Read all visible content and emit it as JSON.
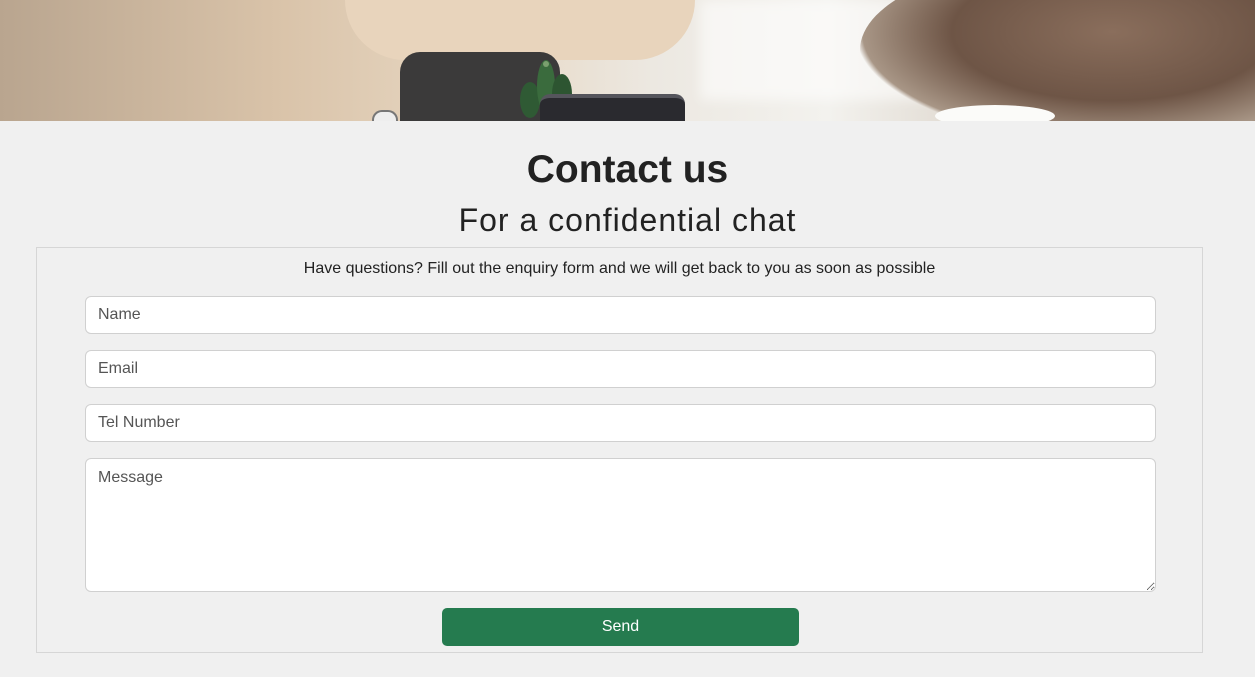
{
  "hero": {
    "image": "office-desk-photo"
  },
  "heading": {
    "title": "Contact us",
    "subtitle": "For a confidential chat"
  },
  "form": {
    "intro": "Have questions? Fill out the enquiry form and we will get back to you as soon as possible",
    "name_placeholder": "Name",
    "email_placeholder": "Email",
    "tel_placeholder": "Tel Number",
    "message_placeholder": "Message",
    "send_label": "Send"
  },
  "colors": {
    "page_background": "#f0f0f0",
    "send_button": "#257b4f"
  }
}
